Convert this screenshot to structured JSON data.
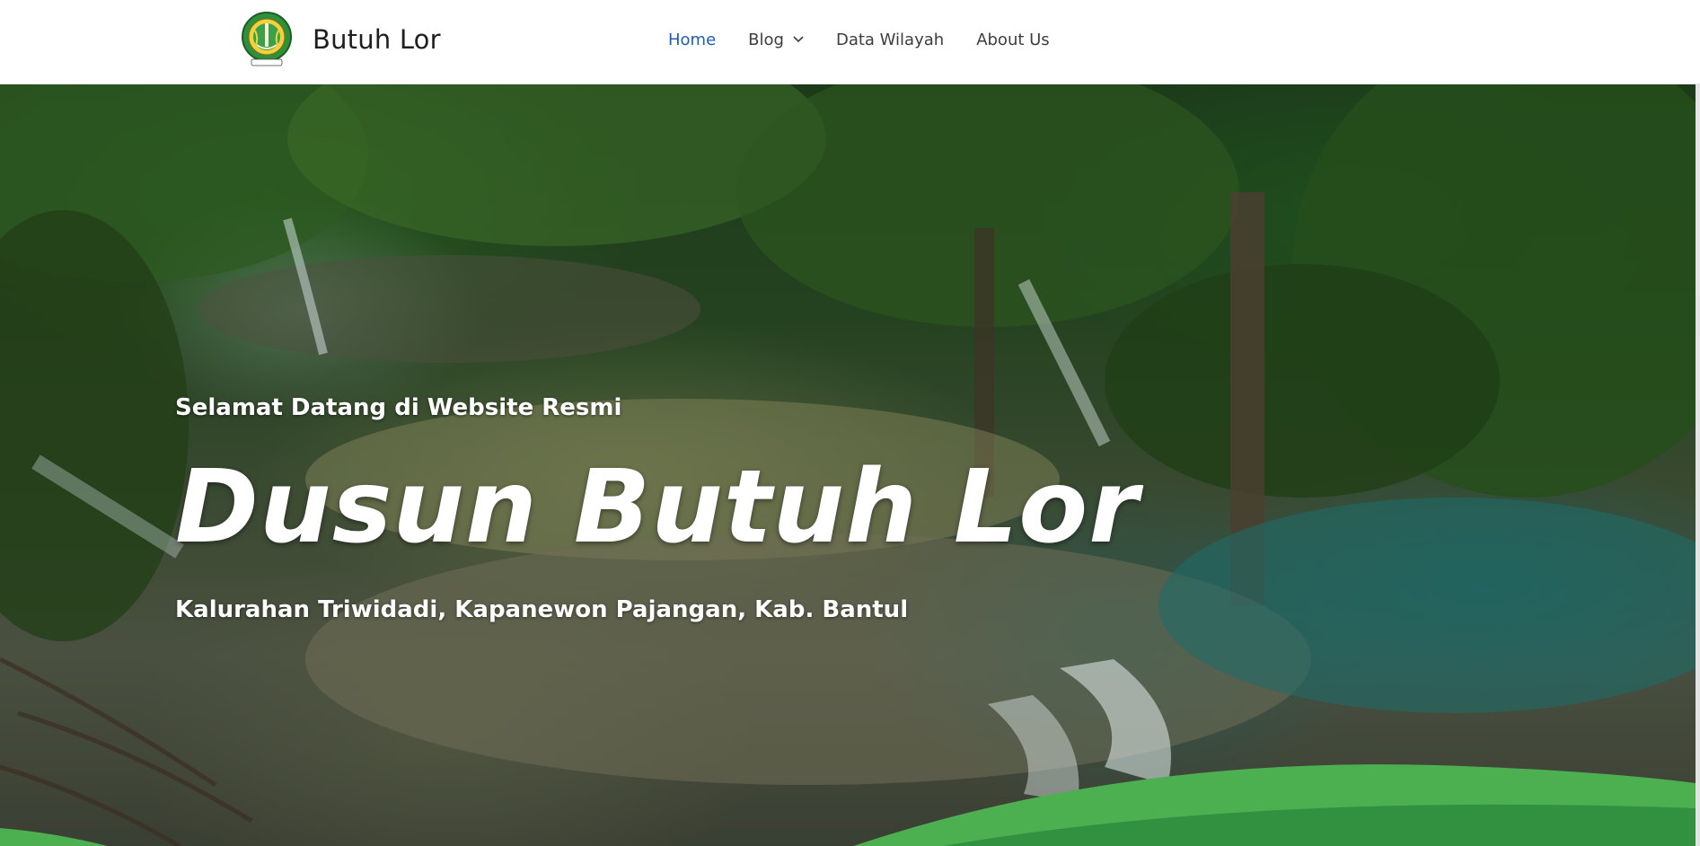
{
  "site": {
    "name": "Butuh Lor"
  },
  "nav": {
    "items": [
      {
        "label": "Home",
        "active": true,
        "has_dropdown": false
      },
      {
        "label": "Blog",
        "active": false,
        "has_dropdown": true
      },
      {
        "label": "Data Wilayah",
        "active": false,
        "has_dropdown": false
      },
      {
        "label": "About Us",
        "active": false,
        "has_dropdown": false
      }
    ]
  },
  "hero": {
    "welcome": "Selamat Datang di Website Resmi",
    "title": "Dusun Butuh Lor",
    "subtitle": "Kalurahan Triwidadi, Kapanewon Pajangan, Kab. Bantul"
  },
  "colors": {
    "nav_active": "#1f5fae",
    "nav_text": "#3d3d3d",
    "wave_light": "#4caf50",
    "wave_dark": "#2e8b3e"
  },
  "icons": {
    "logo": "village-emblem-logo",
    "dropdown": "chevron-down-icon"
  }
}
